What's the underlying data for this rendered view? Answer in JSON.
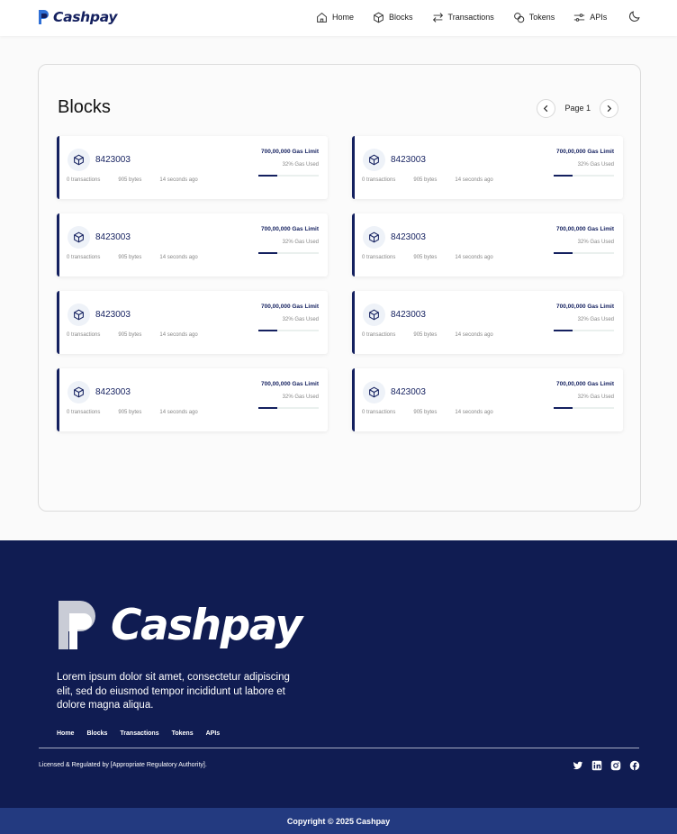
{
  "brand": {
    "name": "Cashpay"
  },
  "nav": {
    "items": [
      {
        "label": "Home",
        "icon": "home-icon"
      },
      {
        "label": "Blocks",
        "icon": "cube-icon"
      },
      {
        "label": "Transactions",
        "icon": "arrows-swap-icon"
      },
      {
        "label": "Tokens",
        "icon": "coins-icon"
      },
      {
        "label": "APIs",
        "icon": "api-icon"
      }
    ],
    "theme_toggle_icon": "moon-icon"
  },
  "blocks": {
    "title": "Blocks",
    "page_label": "Page 1",
    "cards": [
      {
        "number": "8423003",
        "transactions": "0 transactions",
        "size": "905 bytes",
        "time": "14 seconds ago",
        "gas_limit": "700,00,000 Gas Limit",
        "gas_used": "32% Gas Used",
        "gas_fraction": 0.32
      },
      {
        "number": "8423003",
        "transactions": "0 transactions",
        "size": "905 bytes",
        "time": "14 seconds ago",
        "gas_limit": "700,00,000 Gas Limit",
        "gas_used": "32% Gas Used",
        "gas_fraction": 0.32
      },
      {
        "number": "8423003",
        "transactions": "0 transactions",
        "size": "905 bytes",
        "time": "14 seconds ago",
        "gas_limit": "700,00,000 Gas Limit",
        "gas_used": "32% Gas Used",
        "gas_fraction": 0.32
      },
      {
        "number": "8423003",
        "transactions": "0 transactions",
        "size": "905 bytes",
        "time": "14 seconds ago",
        "gas_limit": "700,00,000 Gas Limit",
        "gas_used": "32% Gas Used",
        "gas_fraction": 0.32
      },
      {
        "number": "8423003",
        "transactions": "0 transactions",
        "size": "905 bytes",
        "time": "14 seconds ago",
        "gas_limit": "700,00,000 Gas Limit",
        "gas_used": "32% Gas Used",
        "gas_fraction": 0.32
      },
      {
        "number": "8423003",
        "transactions": "0 transactions",
        "size": "905 bytes",
        "time": "14 seconds ago",
        "gas_limit": "700,00,000 Gas Limit",
        "gas_used": "32% Gas Used",
        "gas_fraction": 0.32
      },
      {
        "number": "8423003",
        "transactions": "0 transactions",
        "size": "905 bytes",
        "time": "14 seconds ago",
        "gas_limit": "700,00,000 Gas Limit",
        "gas_used": "32% Gas Used",
        "gas_fraction": 0.32
      },
      {
        "number": "8423003",
        "transactions": "0 transactions",
        "size": "905 bytes",
        "time": "14 seconds ago",
        "gas_limit": "700,00,000 Gas Limit",
        "gas_used": "32% Gas Used",
        "gas_fraction": 0.32
      }
    ]
  },
  "footer": {
    "brand": "Cashpay",
    "description": "Lorem ipsum dolor sit amet, consectetur adipiscing elit, sed do eiusmod tempor incididunt ut labore et dolore magna aliqua.",
    "nav": [
      "Home",
      "Blocks",
      "Transactions",
      "Tokens",
      "APIs"
    ],
    "license": "Licensed & Regulated by [Appropriate Regulatory Authority].",
    "socials": [
      "twitter-icon",
      "linkedin-icon",
      "instagram-icon",
      "facebook-icon"
    ],
    "copyright": "Copyright © 2025 Cashpay"
  },
  "colors": {
    "brand_navy": "#14205f",
    "footer_bg": "#101c52",
    "copyright_bg": "#233a80"
  }
}
